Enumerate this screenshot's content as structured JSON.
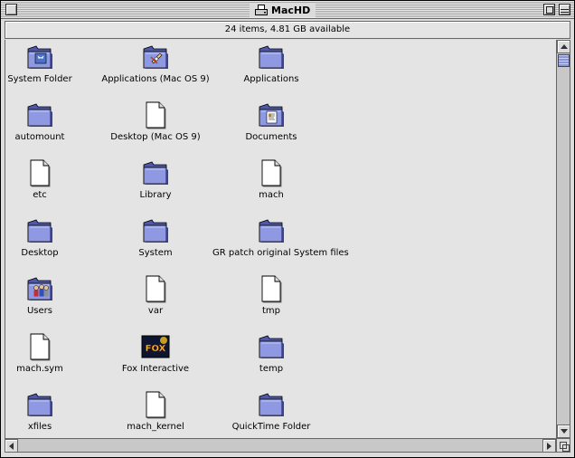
{
  "window": {
    "title": "MacHD",
    "title_icon": "hard-disk-icon",
    "status": "24 items, 4.81 GB available"
  },
  "colors": {
    "folder": "#8f99e2",
    "folder_dark": "#4e58a8",
    "document": "#ffffff",
    "scroll_thumb": "#a7b0e6"
  },
  "items": [
    {
      "label": "System Folder",
      "icon": "system-folder-icon"
    },
    {
      "label": "Applications (Mac OS 9)",
      "icon": "applications-folder-icon"
    },
    {
      "label": "Applications",
      "icon": "folder-icon"
    },
    {
      "label": "automount",
      "icon": "folder-icon"
    },
    {
      "label": "Desktop (Mac OS 9)",
      "icon": "document-icon"
    },
    {
      "label": "Documents",
      "icon": "documents-folder-icon"
    },
    {
      "label": "etc",
      "icon": "document-icon"
    },
    {
      "label": "Library",
      "icon": "folder-icon"
    },
    {
      "label": "mach",
      "icon": "document-icon"
    },
    {
      "label": "Desktop",
      "icon": "folder-icon"
    },
    {
      "label": "System",
      "icon": "folder-icon"
    },
    {
      "label": "GR patch original System files",
      "icon": "folder-icon"
    },
    {
      "label": "Users",
      "icon": "users-folder-icon"
    },
    {
      "label": "var",
      "icon": "document-icon"
    },
    {
      "label": "tmp",
      "icon": "document-icon"
    },
    {
      "label": "mach.sym",
      "icon": "document-icon"
    },
    {
      "label": "Fox Interactive",
      "icon": "fox-interactive-icon"
    },
    {
      "label": "temp",
      "icon": "folder-icon"
    },
    {
      "label": "xfiles",
      "icon": "folder-icon"
    },
    {
      "label": "mach_kernel",
      "icon": "document-icon"
    },
    {
      "label": "QuickTime Folder",
      "icon": "folder-icon"
    }
  ],
  "fox_badge_text": "FOX"
}
